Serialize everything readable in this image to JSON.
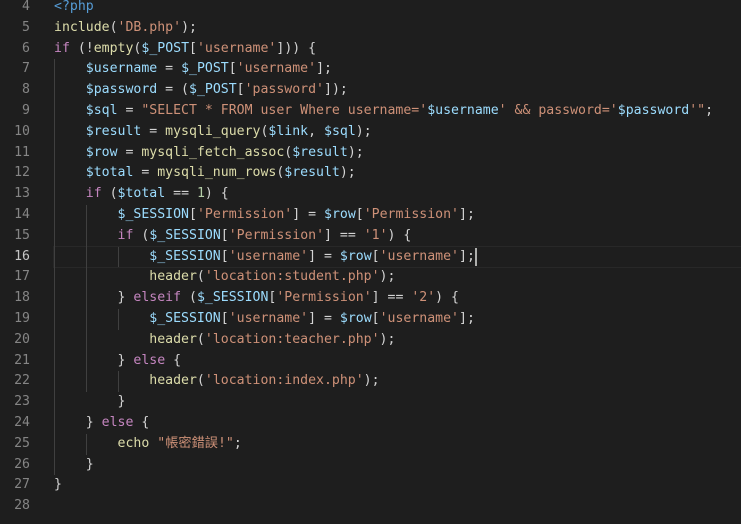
{
  "editor": {
    "first_line_partial": "",
    "current_line": 16,
    "colors": {
      "background": "#1e1e1e",
      "keyword": "#c586c0",
      "function": "#dcdcaa",
      "string": "#ce9178",
      "variable": "#9cdcfe",
      "tag": "#569cd6",
      "number": "#b5cea8",
      "line_number": "#858585"
    },
    "lines": [
      {
        "no": "4",
        "tokens": [
          [
            "t-tag",
            "<?php"
          ]
        ]
      },
      {
        "no": "5",
        "tokens": [
          [
            "t-fn",
            "include"
          ],
          [
            "t-op",
            "("
          ],
          [
            "t-str",
            "'DB.php'"
          ],
          [
            "t-op",
            ");"
          ]
        ]
      },
      {
        "no": "6",
        "tokens": [
          [
            "t-kw",
            "if"
          ],
          [
            "t-op",
            " (!"
          ],
          [
            "t-fn",
            "empty"
          ],
          [
            "t-op",
            "("
          ],
          [
            "t-var",
            "$_POST"
          ],
          [
            "t-op",
            "["
          ],
          [
            "t-str",
            "'username'"
          ],
          [
            "t-op",
            "])) {"
          ]
        ]
      },
      {
        "no": "7",
        "tokens": [
          [
            "t-op",
            "    "
          ],
          [
            "t-var",
            "$username"
          ],
          [
            "t-op",
            " = "
          ],
          [
            "t-var",
            "$_POST"
          ],
          [
            "t-op",
            "["
          ],
          [
            "t-str",
            "'username'"
          ],
          [
            "t-op",
            "];"
          ]
        ]
      },
      {
        "no": "8",
        "tokens": [
          [
            "t-op",
            "    "
          ],
          [
            "t-var",
            "$password"
          ],
          [
            "t-op",
            " = ("
          ],
          [
            "t-var",
            "$_POST"
          ],
          [
            "t-op",
            "["
          ],
          [
            "t-str",
            "'password'"
          ],
          [
            "t-op",
            "]);"
          ]
        ]
      },
      {
        "no": "9",
        "tokens": [
          [
            "t-op",
            "    "
          ],
          [
            "t-var",
            "$sql"
          ],
          [
            "t-op",
            " = "
          ],
          [
            "t-str",
            "\"SELECT * FROM user Where username='"
          ],
          [
            "t-var",
            "$username"
          ],
          [
            "t-str",
            "' && password='"
          ],
          [
            "t-var",
            "$password"
          ],
          [
            "t-str",
            "'\""
          ],
          [
            "t-op",
            ";"
          ]
        ]
      },
      {
        "no": "10",
        "tokens": [
          [
            "t-op",
            "    "
          ],
          [
            "t-var",
            "$result"
          ],
          [
            "t-op",
            " = "
          ],
          [
            "t-fn",
            "mysqli_query"
          ],
          [
            "t-op",
            "("
          ],
          [
            "t-var",
            "$link"
          ],
          [
            "t-op",
            ", "
          ],
          [
            "t-var",
            "$sql"
          ],
          [
            "t-op",
            ");"
          ]
        ]
      },
      {
        "no": "11",
        "tokens": [
          [
            "t-op",
            "    "
          ],
          [
            "t-var",
            "$row"
          ],
          [
            "t-op",
            " = "
          ],
          [
            "t-fn",
            "mysqli_fetch_assoc"
          ],
          [
            "t-op",
            "("
          ],
          [
            "t-var",
            "$result"
          ],
          [
            "t-op",
            ");"
          ]
        ]
      },
      {
        "no": "12",
        "tokens": [
          [
            "t-op",
            "    "
          ],
          [
            "t-var",
            "$total"
          ],
          [
            "t-op",
            " = "
          ],
          [
            "t-fn",
            "mysqli_num_rows"
          ],
          [
            "t-op",
            "("
          ],
          [
            "t-var",
            "$result"
          ],
          [
            "t-op",
            ");"
          ]
        ]
      },
      {
        "no": "13",
        "tokens": [
          [
            "t-op",
            "    "
          ],
          [
            "t-kw",
            "if"
          ],
          [
            "t-op",
            " ("
          ],
          [
            "t-var",
            "$total"
          ],
          [
            "t-op",
            " == "
          ],
          [
            "t-num",
            "1"
          ],
          [
            "t-op",
            ") {"
          ]
        ]
      },
      {
        "no": "14",
        "tokens": [
          [
            "t-op",
            "        "
          ],
          [
            "t-var",
            "$_SESSION"
          ],
          [
            "t-op",
            "["
          ],
          [
            "t-str",
            "'Permission'"
          ],
          [
            "t-op",
            "] = "
          ],
          [
            "t-var",
            "$row"
          ],
          [
            "t-op",
            "["
          ],
          [
            "t-str",
            "'Permission'"
          ],
          [
            "t-op",
            "];"
          ]
        ]
      },
      {
        "no": "15",
        "tokens": [
          [
            "t-op",
            "        "
          ],
          [
            "t-kw",
            "if"
          ],
          [
            "t-op",
            " ("
          ],
          [
            "t-var",
            "$_SESSION"
          ],
          [
            "t-op",
            "["
          ],
          [
            "t-str",
            "'Permission'"
          ],
          [
            "t-op",
            "] == "
          ],
          [
            "t-str",
            "'1'"
          ],
          [
            "t-op",
            ") {"
          ]
        ]
      },
      {
        "no": "16",
        "tokens": [
          [
            "t-op",
            "            "
          ],
          [
            "t-var",
            "$_SESSION"
          ],
          [
            "t-op",
            "["
          ],
          [
            "t-str",
            "'username'"
          ],
          [
            "t-op",
            "] = "
          ],
          [
            "t-var",
            "$row"
          ],
          [
            "t-op",
            "["
          ],
          [
            "t-str",
            "'username'"
          ],
          [
            "t-op",
            "];"
          ]
        ]
      },
      {
        "no": "17",
        "tokens": [
          [
            "t-op",
            "            "
          ],
          [
            "t-fn",
            "header"
          ],
          [
            "t-op",
            "("
          ],
          [
            "t-str",
            "'location:student.php'"
          ],
          [
            "t-op",
            ");"
          ]
        ]
      },
      {
        "no": "18",
        "tokens": [
          [
            "t-op",
            "        } "
          ],
          [
            "t-kw",
            "elseif"
          ],
          [
            "t-op",
            " ("
          ],
          [
            "t-var",
            "$_SESSION"
          ],
          [
            "t-op",
            "["
          ],
          [
            "t-str",
            "'Permission'"
          ],
          [
            "t-op",
            "] == "
          ],
          [
            "t-str",
            "'2'"
          ],
          [
            "t-op",
            ") {"
          ]
        ]
      },
      {
        "no": "19",
        "tokens": [
          [
            "t-op",
            "            "
          ],
          [
            "t-var",
            "$_SESSION"
          ],
          [
            "t-op",
            "["
          ],
          [
            "t-str",
            "'username'"
          ],
          [
            "t-op",
            "] = "
          ],
          [
            "t-var",
            "$row"
          ],
          [
            "t-op",
            "["
          ],
          [
            "t-str",
            "'username'"
          ],
          [
            "t-op",
            "];"
          ]
        ]
      },
      {
        "no": "20",
        "tokens": [
          [
            "t-op",
            "            "
          ],
          [
            "t-fn",
            "header"
          ],
          [
            "t-op",
            "("
          ],
          [
            "t-str",
            "'location:teacher.php'"
          ],
          [
            "t-op",
            ");"
          ]
        ]
      },
      {
        "no": "21",
        "tokens": [
          [
            "t-op",
            "        } "
          ],
          [
            "t-kw",
            "else"
          ],
          [
            "t-op",
            " {"
          ]
        ]
      },
      {
        "no": "22",
        "tokens": [
          [
            "t-op",
            "            "
          ],
          [
            "t-fn",
            "header"
          ],
          [
            "t-op",
            "("
          ],
          [
            "t-str",
            "'location:index.php'"
          ],
          [
            "t-op",
            ");"
          ]
        ]
      },
      {
        "no": "23",
        "tokens": [
          [
            "t-op",
            "        }"
          ]
        ]
      },
      {
        "no": "24",
        "tokens": [
          [
            "t-op",
            "    } "
          ],
          [
            "t-kw",
            "else"
          ],
          [
            "t-op",
            " {"
          ]
        ]
      },
      {
        "no": "25",
        "tokens": [
          [
            "t-op",
            "        "
          ],
          [
            "t-fn",
            "echo"
          ],
          [
            "t-op",
            " "
          ],
          [
            "t-str",
            "\"帳密錯誤!\""
          ],
          [
            "t-op",
            ";"
          ]
        ]
      },
      {
        "no": "26",
        "tokens": [
          [
            "t-op",
            "    }"
          ]
        ]
      },
      {
        "no": "27",
        "tokens": [
          [
            "t-op",
            "}"
          ]
        ]
      },
      {
        "no": "28",
        "tokens": []
      }
    ]
  }
}
